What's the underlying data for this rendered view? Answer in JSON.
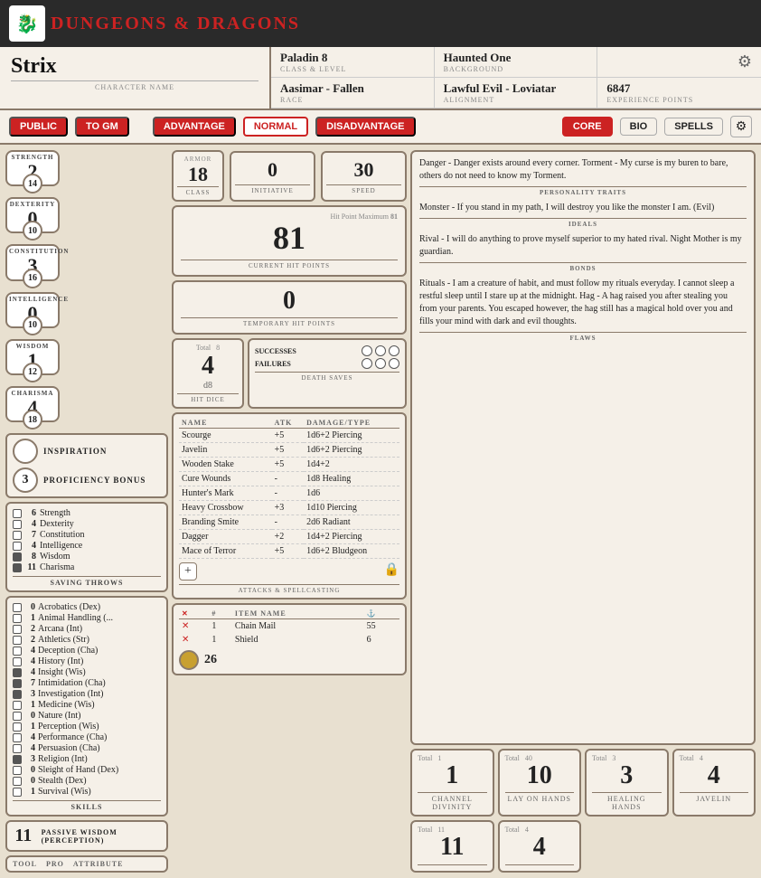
{
  "header": {
    "title_part1": "DUNGEONS ",
    "title_ampersand": "&",
    "title_part2": " DRAGONS"
  },
  "character": {
    "name": "Strix",
    "name_label": "CHARACTER NAME",
    "class_level": "Paladin 8",
    "class_level_label": "CLASS & LEVEL",
    "background": "Haunted One",
    "background_label": "BACKGROUND",
    "race": "Aasimar - Fallen",
    "race_label": "RACE",
    "alignment": "Lawful Evil - Loviatar",
    "alignment_label": "ALIGNMENT",
    "xp": "6847",
    "xp_label": "EXPERIENCE POINTS"
  },
  "tabs": {
    "public": "PUBLIC",
    "to_gm": "TO GM",
    "advantage": "ADVANTAGE",
    "normal": "NORMAL",
    "disadvantage": "DISADVANTAGE",
    "core": "CORE",
    "bio": "BIO",
    "spells": "SPELLS"
  },
  "abilities": [
    {
      "label": "STRENGTH",
      "modifier": "2",
      "score": "14"
    },
    {
      "label": "DEXTERITY",
      "modifier": "0",
      "score": "10"
    },
    {
      "label": "CONSTITUTION",
      "modifier": "3",
      "score": "16"
    },
    {
      "label": "INTELLIGENCE",
      "modifier": "0",
      "score": "10"
    },
    {
      "label": "WISDOM",
      "modifier": "1",
      "score": "12"
    },
    {
      "label": "CHARISMA",
      "modifier": "4",
      "score": "18"
    }
  ],
  "inspiration": "",
  "inspiration_label": "INSPIRATION",
  "proficiency_bonus": "3",
  "proficiency_label": "PROFICIENCY BONUS",
  "saving_throws": [
    {
      "checked": false,
      "value": "6",
      "name": "Strength"
    },
    {
      "checked": false,
      "value": "4",
      "name": "Dexterity"
    },
    {
      "checked": false,
      "value": "7",
      "name": "Constitution"
    },
    {
      "checked": false,
      "value": "4",
      "name": "Intelligence"
    },
    {
      "checked": true,
      "value": "8",
      "name": "Wisdom"
    },
    {
      "checked": true,
      "value": "11",
      "name": "Charisma"
    }
  ],
  "saving_throws_label": "SAVING THROWS",
  "skills": [
    {
      "checked": false,
      "value": "0",
      "name": "Acrobatics (Dex)"
    },
    {
      "checked": false,
      "value": "1",
      "name": "Animal Handling (..."
    },
    {
      "checked": false,
      "value": "2",
      "name": "Arcana (Int)"
    },
    {
      "checked": false,
      "value": "2",
      "name": "Athletics (Str)"
    },
    {
      "checked": false,
      "value": "4",
      "name": "Deception (Cha)"
    },
    {
      "checked": false,
      "value": "4",
      "name": "History (Int)"
    },
    {
      "checked": true,
      "value": "4",
      "name": "Insight (Wis)"
    },
    {
      "checked": true,
      "value": "7",
      "name": "Intimidation (Cha)"
    },
    {
      "checked": true,
      "value": "3",
      "name": "Investigation (Int)"
    },
    {
      "checked": false,
      "value": "1",
      "name": "Medicine (Wis)"
    },
    {
      "checked": false,
      "value": "0",
      "name": "Nature (Int)"
    },
    {
      "checked": false,
      "value": "1",
      "name": "Perception (Wis)"
    },
    {
      "checked": false,
      "value": "4",
      "name": "Performance (Cha)"
    },
    {
      "checked": false,
      "value": "4",
      "name": "Persuasion (Cha)"
    },
    {
      "checked": true,
      "value": "3",
      "name": "Religion (Int)"
    },
    {
      "checked": false,
      "value": "0",
      "name": "Sleight of Hand (Dex)"
    },
    {
      "checked": false,
      "value": "0",
      "name": "Stealth (Dex)"
    },
    {
      "checked": false,
      "value": "1",
      "name": "Survival (Wis)"
    }
  ],
  "skills_label": "SKILLS",
  "passive_wisdom": "11",
  "passive_label": "PASSIVE WISDOM (PERCEPTION)",
  "tool_label": "TOOL",
  "pro_label": "PRO",
  "attribute_label": "ATTRIBUTE",
  "combat": {
    "armor_class": "18",
    "armor_label": "ARMOR CLASS",
    "initiative": "0",
    "initiative_label": "INITIATIVE",
    "speed": "30",
    "speed_label": "SPEED",
    "hp_max": "81",
    "hp_max_label": "Hit Point Maximum",
    "current_hp": "81",
    "current_hp_label": "CURRENT HIT POINTS",
    "temp_hp": "0",
    "temp_hp_label": "TEMPORARY HIT POINTS",
    "hit_dice_total": "Total",
    "hit_dice_val": "4",
    "hit_dice_type": "8",
    "hit_dice_label": "HIT DICE",
    "death_total": "8",
    "successes_label": "SUCCESSES",
    "failures_label": "FAILURES",
    "death_label": "DEATH SAVES"
  },
  "attacks": [
    {
      "name": "Scourge",
      "atk": "+5",
      "damage": "1d6+2 Piercing"
    },
    {
      "name": "Javelin",
      "atk": "+5",
      "damage": "1d6+2 Piercing"
    },
    {
      "name": "Wooden Stake",
      "atk": "+5",
      "damage": "1d4+2"
    },
    {
      "name": "Cure Wounds",
      "atk": "-",
      "damage": "1d8 Healing"
    },
    {
      "name": "Hunter's Mark",
      "atk": "-",
      "damage": "1d6"
    },
    {
      "name": "Heavy Crossbow",
      "atk": "+3",
      "damage": "1d10 Piercing"
    },
    {
      "name": "Branding Smite",
      "atk": "-",
      "damage": "2d6 Radiant"
    },
    {
      "name": "Dagger",
      "atk": "+2",
      "damage": "1d4+2 Piercing"
    },
    {
      "name": "Mace of Terror",
      "atk": "+5",
      "damage": "1d6+2 Bludgeon"
    }
  ],
  "attacks_col_name": "NAME",
  "attacks_col_atk": "ATK",
  "attacks_col_damage": "DAMAGE/TYPE",
  "attacks_label": "ATTACKS & SPELLCASTING",
  "equipment": {
    "col_x": "✕",
    "col_qty": "1",
    "col_name": "ITEM NAME",
    "col_wt": "⚓",
    "items": [
      {
        "qty": "1",
        "name": "Chain Mail",
        "wt": "55"
      },
      {
        "qty": "1",
        "name": "Shield",
        "wt": "6"
      }
    ]
  },
  "coin": "26",
  "traits": {
    "personality": "Danger - Danger exists around every corner.\n\nTorment - My curse is my buren to bare, others do not need to know my Torment.",
    "personality_label": "PERSONALITY TRAITS",
    "ideals": "Monster - If you stand in my path, I will destroy you like the monster I am. (Evil)",
    "ideals_label": "IDEALS",
    "bonds": "Rival - I will do anything to prove myself superior to my hated rival.\n\nNight Mother is my guardian.",
    "bonds_label": "BONDS",
    "flaws": "Rituals - I am a creature of habit, and must follow my rituals everyday. I cannot sleep a restful sleep until I stare up at the midnight.\n\nHag - A hag raised you after stealing you from your parents. You escaped however, the hag still has a magical hold over you and fills your mind with dark and evil thoughts.",
    "flaws_label": "FLAWS"
  },
  "bottom_abilities": [
    {
      "total_label": "Total",
      "value": "1",
      "label": "Channel Divinity"
    },
    {
      "total_label": "Total",
      "value": "10",
      "label": "Lay On Hands"
    },
    {
      "total_label": "Total",
      "value": "3",
      "label": "Healing Hands"
    },
    {
      "total_label": "Total",
      "value": "4",
      "label": "Javelin"
    },
    {
      "total_label": "Total",
      "value": "11",
      "label": ""
    },
    {
      "total_label": "Total",
      "value": "4",
      "label": ""
    }
  ]
}
